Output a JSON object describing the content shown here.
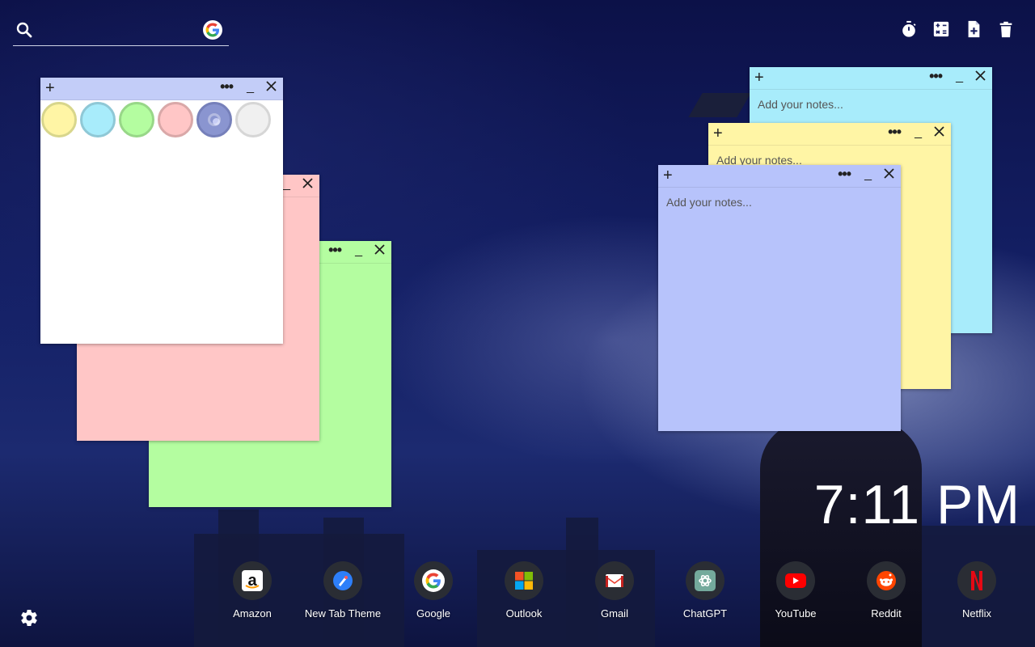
{
  "search": {
    "placeholder": ""
  },
  "toolbar": {
    "items": [
      {
        "name": "timer",
        "icon": "timer-icon"
      },
      {
        "name": "calculator",
        "icon": "calculator-icon"
      },
      {
        "name": "new-note",
        "icon": "note-add-icon"
      },
      {
        "name": "delete",
        "icon": "trash-icon"
      }
    ]
  },
  "notes": {
    "placeholder": "Add your notes...",
    "colors": {
      "yellow": "#fff5a5",
      "blue": "#a8ecfb",
      "green": "#b4fda0",
      "red": "#ffc6c6",
      "purple": "#b7c3fb",
      "white": "#ffffff"
    },
    "palette": [
      "yellow",
      "blue",
      "green",
      "red",
      "purple",
      "white"
    ]
  },
  "clock": {
    "time": "7:11 PM"
  },
  "shortcuts": [
    {
      "label": "Amazon",
      "icon": "amazon-icon"
    },
    {
      "label": "New Tab Theme",
      "icon": "new-tab-theme-icon"
    },
    {
      "label": "Google",
      "icon": "google-icon"
    },
    {
      "label": "Outlook",
      "icon": "outlook-icon"
    },
    {
      "label": "Gmail",
      "icon": "gmail-icon"
    },
    {
      "label": "ChatGPT",
      "icon": "chatgpt-icon"
    },
    {
      "label": "YouTube",
      "icon": "youtube-icon"
    },
    {
      "label": "Reddit",
      "icon": "reddit-icon"
    },
    {
      "label": "Netflix",
      "icon": "netflix-icon"
    }
  ]
}
